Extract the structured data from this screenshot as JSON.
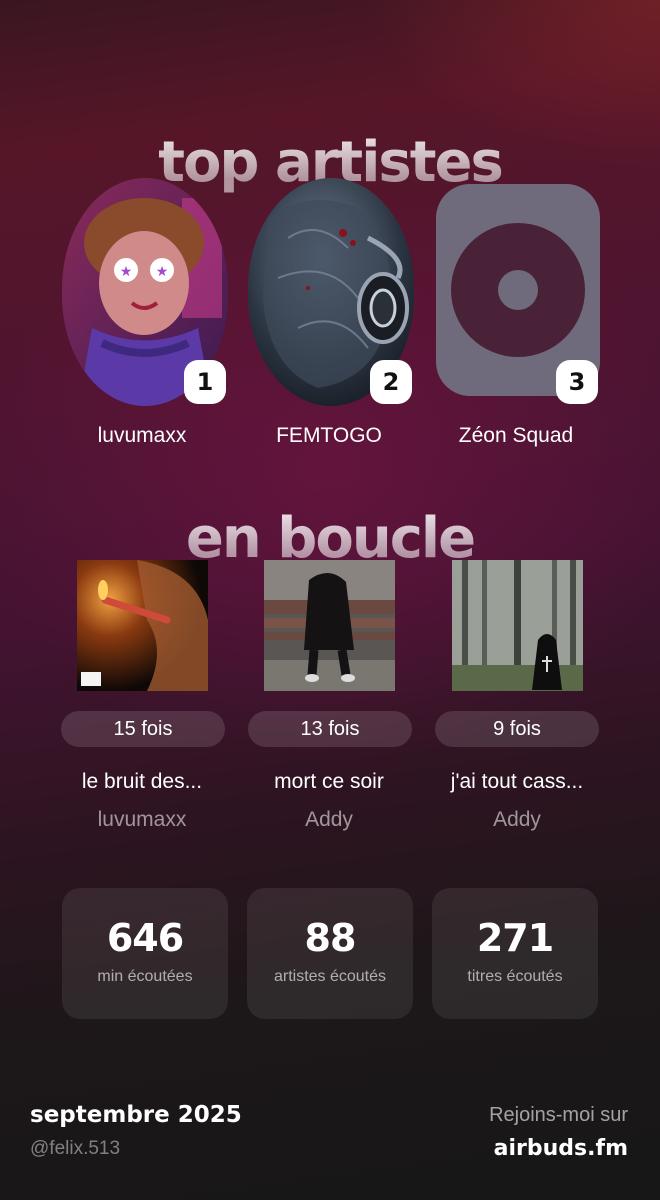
{
  "sections": {
    "top_artists_title": "top artistes",
    "loop_title": "en boucle"
  },
  "top_artists": [
    {
      "rank": "1",
      "name": "luvumaxx",
      "image": "cartoon-portrait-image"
    },
    {
      "rank": "2",
      "name": "FEMTOGO",
      "image": "headphone-art-image"
    },
    {
      "rank": "3",
      "name": "Zéon Squad",
      "image": "placeholder-disc-icon"
    }
  ],
  "loop": [
    {
      "count": "15 fois",
      "title": "le bruit des...",
      "artist": "luvumaxx",
      "cover": "candle-cover-image"
    },
    {
      "count": "13 fois",
      "title": "mort ce soir",
      "artist": "Addy",
      "cover": "bench-cover-image"
    },
    {
      "count": "9 fois",
      "title": "j'ai tout cass...",
      "artist": "Addy",
      "cover": "forest-cover-image"
    }
  ],
  "stats": [
    {
      "value": "646",
      "label": "min écoutées"
    },
    {
      "value": "88",
      "label": "artistes écoutés"
    },
    {
      "value": "271",
      "label": "titres écoutés"
    }
  ],
  "footer": {
    "month": "septembre 2025",
    "handle": "@felix.513",
    "join": "Rejoins-moi sur",
    "site": "airbuds.fm"
  },
  "colors": {
    "accent_bg": "#4e1430",
    "rank_badge": "#ffffff",
    "placeholder_fill": "#6f6a7c"
  }
}
